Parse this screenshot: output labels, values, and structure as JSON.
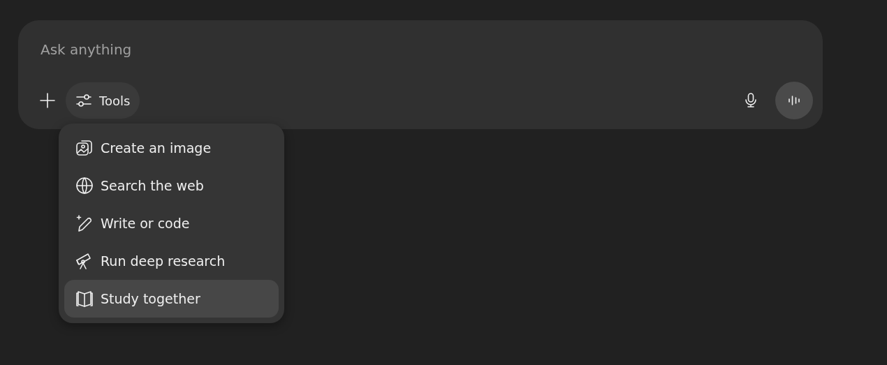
{
  "composer": {
    "placeholder": "Ask anything",
    "tools_button": {
      "label": "Tools"
    }
  },
  "tools_menu": {
    "items": [
      {
        "kind": "image",
        "label": "Create an image",
        "selected": false
      },
      {
        "kind": "globe",
        "label": "Search the web",
        "selected": false
      },
      {
        "kind": "pen",
        "label": "Write or code",
        "selected": false
      },
      {
        "kind": "telescope",
        "label": "Run deep research",
        "selected": false
      },
      {
        "kind": "book",
        "label": "Study together",
        "selected": true
      }
    ]
  }
}
